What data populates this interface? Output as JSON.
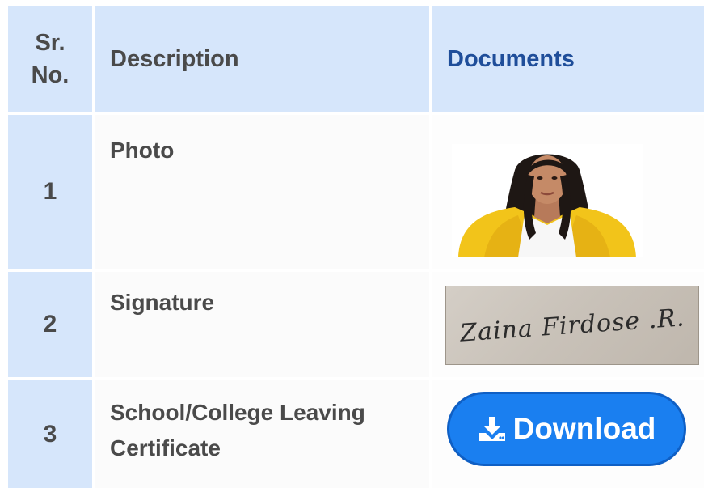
{
  "table": {
    "headers": {
      "sr_no": "Sr.\nNo.",
      "description": "Description",
      "documents": "Documents"
    },
    "rows": [
      {
        "sr": "1",
        "description": "Photo",
        "document_type": "photo"
      },
      {
        "sr": "2",
        "description": "Signature",
        "document_type": "signature",
        "signature_text": "Zaina Firdose .R."
      },
      {
        "sr": "3",
        "description": "School/College Leaving Certificate",
        "document_type": "download",
        "button_label": "Download"
      }
    ]
  },
  "icons": {
    "download": "download-icon"
  },
  "colors": {
    "header_bg": "#d6e6fb",
    "documents_header_text": "#1f4e9a",
    "button_bg": "#1a7ff0",
    "photo_jacket": "#f2c41a"
  }
}
